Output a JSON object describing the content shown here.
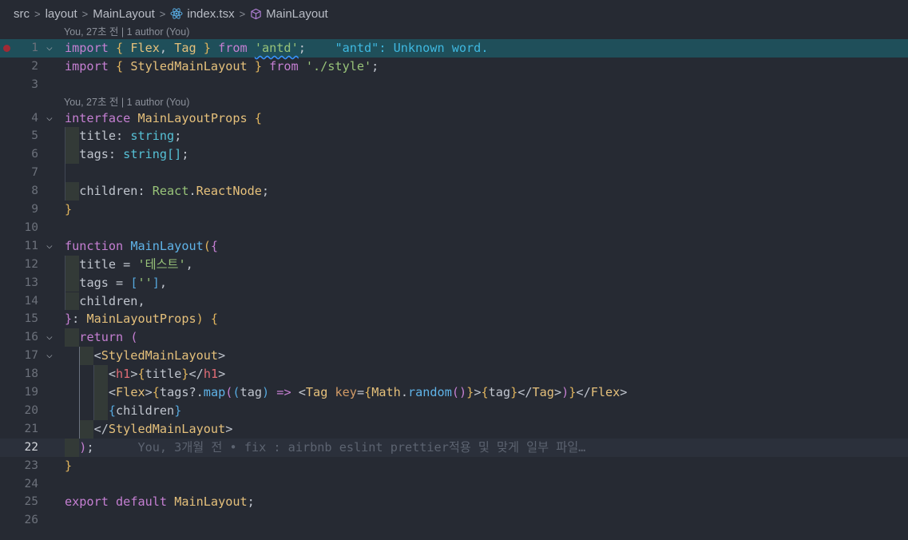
{
  "breadcrumb": {
    "items": [
      "src",
      "layout",
      "MainLayout",
      "index.tsx",
      "MainLayout"
    ],
    "separator": ">"
  },
  "editor": {
    "codelens": [
      "You, 27초 전 | 1 author (You)",
      "You, 27초 전 | 1 author (You)"
    ],
    "diagnostic": "\"antd\": Unknown word.",
    "blame": "You, 3개월 전 • fix : airbnb eslint prettier적용 및 맞게 일부 파일…",
    "line_numbers": [
      "1",
      "2",
      "3",
      "4",
      "5",
      "6",
      "7",
      "8",
      "9",
      "10",
      "11",
      "12",
      "13",
      "14",
      "15",
      "16",
      "17",
      "18",
      "19",
      "20",
      "21",
      "22",
      "23",
      "24",
      "25",
      "26"
    ],
    "active_line": "22",
    "tokens": {
      "import": "import",
      "from": "from",
      "interface": "interface",
      "function": "function",
      "return": "return",
      "export": "export",
      "default": "default",
      "Flex": "Flex",
      "Tag": "Tag",
      "antd_str": "'antd'",
      "StyledMainLayout": "StyledMainLayout",
      "style_str": "'./style'",
      "MainLayoutProps": "MainLayoutProps",
      "title": "title",
      "tags": "tags",
      "children": "children",
      "string": "string",
      "string_arr": "string[]",
      "React": "React",
      "ReactNode": "ReactNode",
      "MainLayout": "MainLayout",
      "test_str": "'테스트'",
      "empty_str": "''",
      "h1": "h1",
      "map": "map",
      "tag": "tag",
      "key": "key",
      "Math": "Math",
      "random": "random"
    }
  }
}
